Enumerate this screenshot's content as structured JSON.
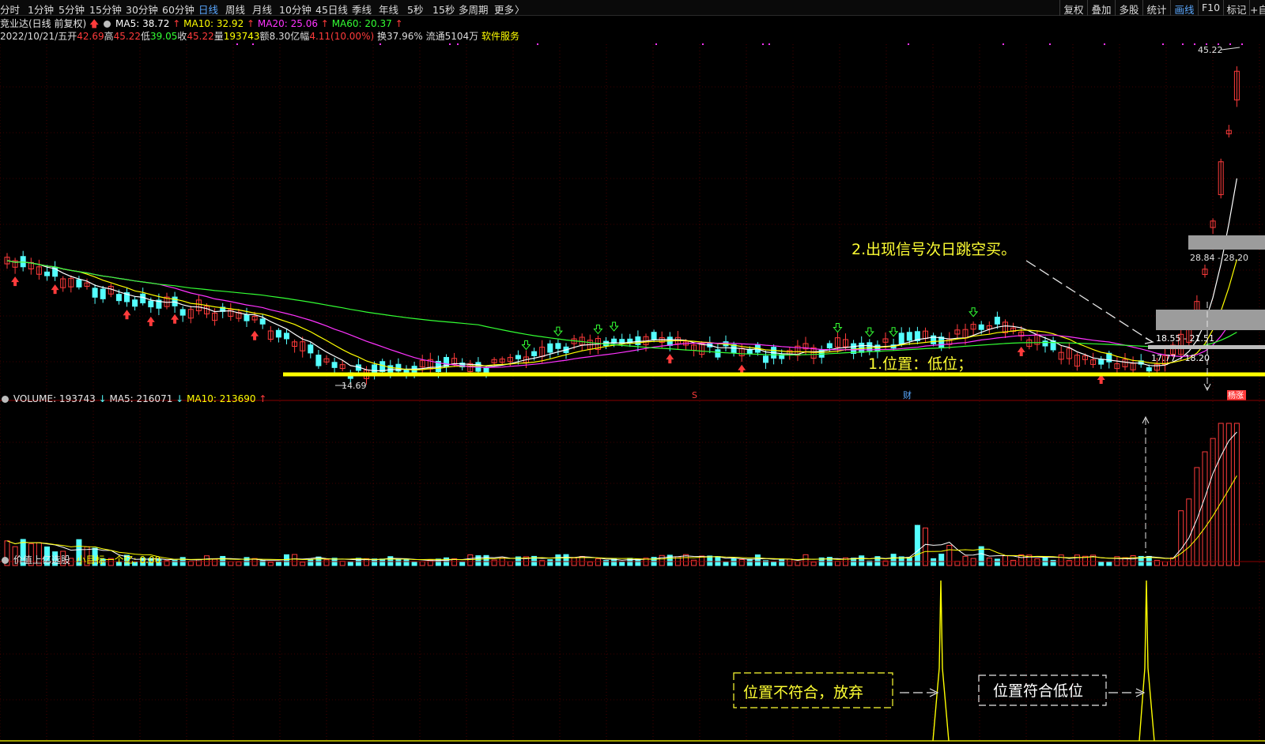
{
  "toolbar": {
    "periods": [
      {
        "label": "分时",
        "active": false
      },
      {
        "label": "1分钟",
        "active": false
      },
      {
        "label": "5分钟",
        "active": false
      },
      {
        "label": "15分钟",
        "active": false
      },
      {
        "label": "30分钟",
        "active": false
      },
      {
        "label": "60分钟",
        "active": false
      },
      {
        "label": "日线",
        "active": true
      },
      {
        "label": "周线",
        "active": false
      },
      {
        "label": "月线",
        "active": false
      },
      {
        "label": "10分钟",
        "active": false
      },
      {
        "label": "45日线",
        "active": false
      },
      {
        "label": "季线",
        "active": false
      },
      {
        "label": "年线",
        "active": false
      },
      {
        "label": "5秒",
        "active": false
      },
      {
        "label": "15秒",
        "active": false
      },
      {
        "label": "多周期",
        "active": false
      },
      {
        "label": "更多",
        "active": false
      }
    ],
    "more_glyph": "〉",
    "right_buttons": [
      {
        "label": "复权",
        "active": false
      },
      {
        "label": "叠加",
        "active": false
      },
      {
        "label": "多股",
        "active": false
      },
      {
        "label": "统计",
        "active": false
      },
      {
        "label": "画线",
        "active": true
      },
      {
        "label": "F10",
        "active": false
      },
      {
        "label": "标记",
        "active": false
      },
      {
        "label": "+自",
        "active": false
      }
    ]
  },
  "stock": {
    "name": "竞业达(日线 前复权)",
    "ma5": "MA5: 38.72",
    "ma10": "MA10: 32.92",
    "ma20": "MA20: 25.06",
    "ma60": "MA60: 20.37",
    "date": "2022/10/21/五",
    "open_label": "开",
    "open": "42.69",
    "high_label": "高",
    "high": "45.22",
    "low_label": "低",
    "low": "39.05",
    "close_label": "收",
    "close": "45.22",
    "vol_label": "量",
    "vol": "193743",
    "amount_label": "额",
    "amount": "8.30亿",
    "change_label": "幅",
    "change": "4.11(10.00%)",
    "turnover": "换37.96%",
    "float": "流通5104万",
    "sector": "软件服务"
  },
  "price_labels": {
    "high": "45.22",
    "low": "14.69",
    "box1": "28.84 - 28.20",
    "box2": "18.55 - 21.51",
    "box3": "17.77 - 18.20",
    "s_marker": "S",
    "cai_marker": "财",
    "badge": "杨涨"
  },
  "annotations": {
    "signal_text": "2.出现信号次日跳空买。",
    "position_text": "1.位置：低位；",
    "reject_text": "位置不符合，放弃",
    "accept_text": "位置符合低位"
  },
  "volume_header": {
    "label": "VOLUME: 193743",
    "ma5": "MA5: 216071",
    "ma10": "MA10: 213690"
  },
  "indicator_header": {
    "name": "价值上亿选股",
    "sub": "小目标一个亿: 0.00"
  },
  "colors": {
    "up": "#ff3b3b",
    "down": "#54ffff",
    "ma5": "#ffffff",
    "ma10": "#ffff00",
    "ma20": "#ff33ff",
    "ma60": "#33ff33",
    "grid": "#7a0000",
    "support_line": "#ffff00",
    "annotation": "#ffff33",
    "active_tab": "#5aa8ff"
  }
}
